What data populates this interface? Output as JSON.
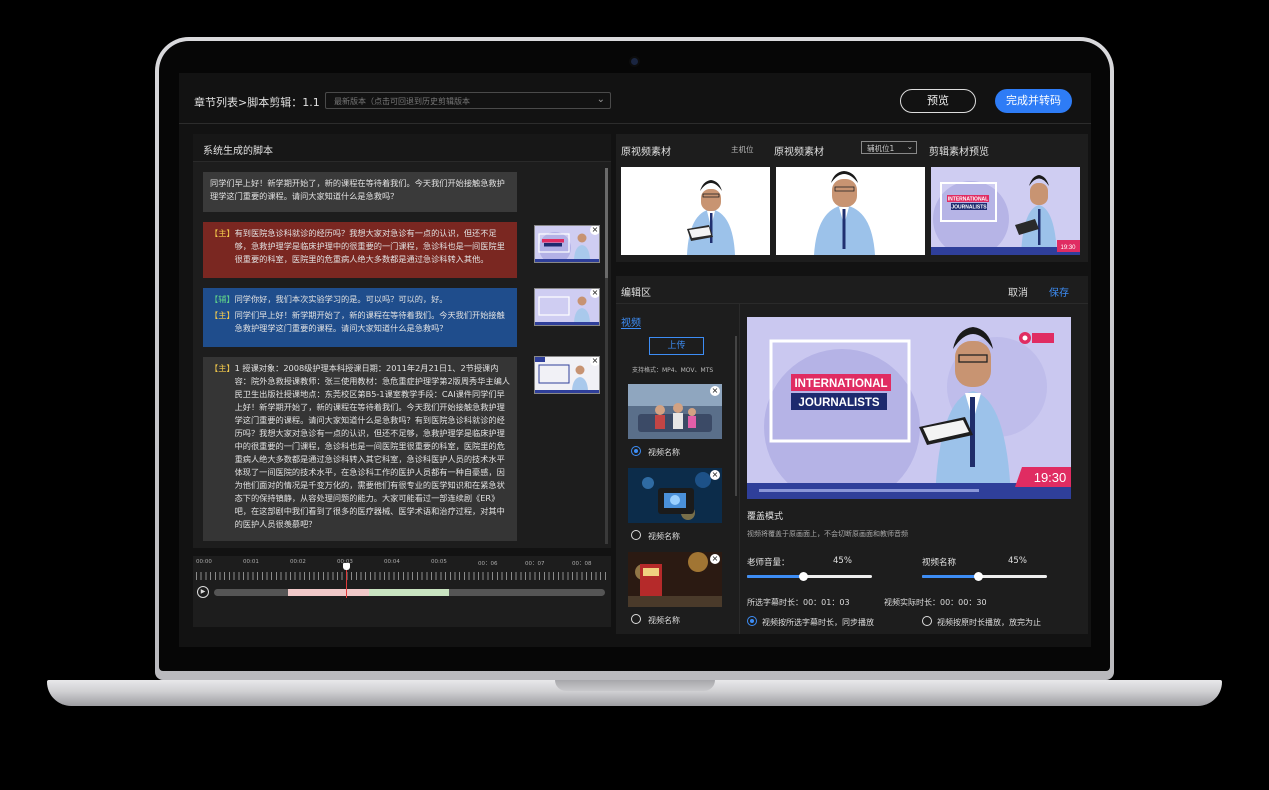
{
  "topbar": {
    "breadcrumb": "章节列表>脚本剪辑：1.1",
    "version_placeholder": "最新版本（点击可回退到历史剪辑版本",
    "preview_label": "预览",
    "finish_label": "完成并转码"
  },
  "script": {
    "title": "系统生成的脚本",
    "block1": "同学们早上好！新学期开始了，新的课程在等待着我们。今天我们开始接触急救护理学这门重要的课程。请问大家知道什么是急救吗？",
    "block2_tag": "【主】",
    "block2": "有到医院急诊科就诊的经历吗？我想大家对急诊有一点的认识，但还不足够，急救护理学是临床护理中的很重要的一门课程，急诊科也是一间医院里很重要的科室，医院里的危重病人绝大多数都是通过急诊科转入其他。",
    "block3_tag1": "【辅】",
    "block3_line1": "同学你好，我们本次实验学习的是。可以吗？可以的，好。",
    "block3_tag2": "【主】",
    "block3_line2": "同学们早上好！新学期开始了，新的课程在等待着我们。今天我们开始接触急救护理学这门重要的课程。请问大家知道什么是急救吗？",
    "block4_tag": "【主】",
    "block4": "1 授课对象：2008级护理本科授课日期：2011年2月21日1、2节授课内容：院外急救授课教师：张三使用教材：急危重症护理学第2版周秀华主编人民卫生出版社授课地点：东莞校区第B5-1课室教学手段：CAI课件同学们早上好！新学期开始了，新的课程在等待着我们。今天我们开始接触急救护理学这门重要的课程。请问大家知道什么是急救吗？有到医院急诊科就诊的经历吗？我想大家对急诊有一点的认识，但还不足够，急救护理学是临床护理中的很重要的一门课程，急诊科也是一间医院里很重要的科室，医院里的危重病人绝大多数都是通过急诊科转入其它科室，急诊科医护人员的技术水平体现了一间医院的技术水平，在急诊科工作的医护人员都有一种自豪感，因为他们面对的情况是千变万化的，需要他们有很专业的医学知识和在紧急状态下的保持镇静，从容处理问题的能力。大家可能看过一部连续剧《ER》吧，在这部剧中我们看到了很多的医疗器械、医学术语和治疗过程，对其中的医护人员很羡慕吧？"
  },
  "timeline": {
    "ticks": [
      "00:00",
      "00:01",
      "00:02",
      "00:03",
      "00:04",
      "00:05",
      "00：06",
      "00：07",
      "00：08"
    ]
  },
  "source": {
    "title1": "原视频素材",
    "cam1": "主机位",
    "title2": "原视频素材",
    "cam2_select": "辅机位1",
    "title3": "剪辑素材预览"
  },
  "overlay": {
    "line1": "INTERNATIONAL",
    "line2": "JOURNALISTS",
    "time": "19:30"
  },
  "edit": {
    "title": "编辑区",
    "cancel_label": "取消",
    "save_label": "保存",
    "tab_video": "视频",
    "upload_label": "上传",
    "formats": "支持格式：MP4、MOV、MTS",
    "items": [
      {
        "name": "视频名称"
      },
      {
        "name": "视频名称"
      },
      {
        "name": "视频名称"
      }
    ],
    "mode_title": "覆盖模式",
    "mode_desc": "视频将覆盖于原画面上，不会切断原画面和教师音频",
    "teacher_volume_label": "老师音量：",
    "teacher_volume_value": "45%",
    "teacher_volume": 0.45,
    "video_name_label": "视频名称",
    "video_volume_value": "45%",
    "video_volume": 0.45,
    "subtitle_duration": "所选字幕时长：00：01：03",
    "video_duration": "视频实际时长：00：00：30",
    "option1": "视频按所选字幕时长，同步播放",
    "option2": "视频按原时长播放，放完为止"
  },
  "colors": {
    "accent": "#2e7cf6",
    "main_block": "#7a2721",
    "aux_block": "#1f4d8c",
    "tag_main": "#f2c94c",
    "tag_aux": "#5fd18a"
  }
}
